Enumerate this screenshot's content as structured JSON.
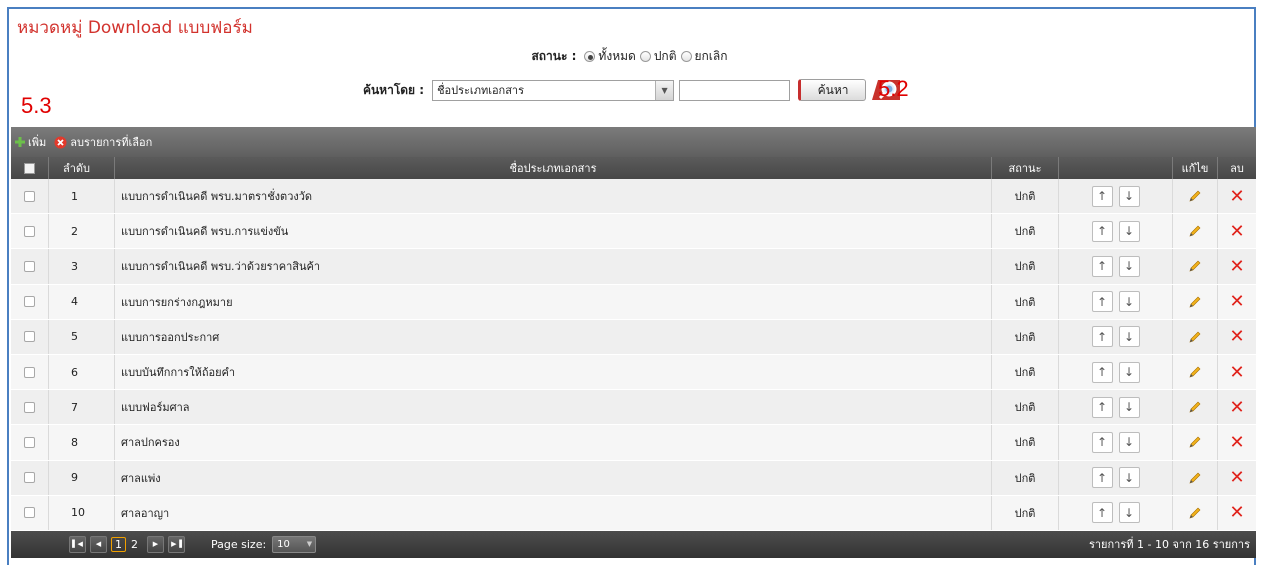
{
  "page": {
    "title": "หมวดหมู่ Download แบบฟอร์ม",
    "annotations": {
      "left": "5.3",
      "search": "5.2"
    }
  },
  "filter": {
    "status_label": "สถานะ :",
    "status_options": [
      {
        "label": "ทั้งหมด",
        "checked": true
      },
      {
        "label": "ปกติ",
        "checked": false
      },
      {
        "label": "ยกเลิก",
        "checked": false
      }
    ],
    "search_by_label": "ค้นหาโดย :",
    "search_by_value": "ชื่อประเภทเอกสาร",
    "search_text_value": "",
    "search_button": "ค้นหา"
  },
  "toolbar": {
    "add_label": "เพิ่ม",
    "delete_selected_label": "ลบรายการที่เลือก"
  },
  "table": {
    "headers": {
      "order": "ลำดับ",
      "name": "ชื่อประเภทเอกสาร",
      "status": "สถานะ",
      "edit": "แก้ไข",
      "delete": "ลบ"
    },
    "rows": [
      {
        "no": "1",
        "name": "แบบการดำเนินคดี พรบ.มาตราชั่งตวงวัด",
        "status": "ปกติ"
      },
      {
        "no": "2",
        "name": "แบบการดำเนินคดี พรบ.การแข่งขัน",
        "status": "ปกติ"
      },
      {
        "no": "3",
        "name": "แบบการดำเนินคดี พรบ.ว่าด้วยราคาสินค้า",
        "status": "ปกติ"
      },
      {
        "no": "4",
        "name": "แบบการยกร่างกฎหมาย",
        "status": "ปกติ"
      },
      {
        "no": "5",
        "name": "แบบการออกประกาศ",
        "status": "ปกติ"
      },
      {
        "no": "6",
        "name": "แบบบันทึกการให้ถ้อยคำ",
        "status": "ปกติ"
      },
      {
        "no": "7",
        "name": "แบบฟอร์มศาล",
        "status": "ปกติ"
      },
      {
        "no": "8",
        "name": "ศาลปกครอง",
        "status": "ปกติ"
      },
      {
        "no": "9",
        "name": "ศาลแพ่ง",
        "status": "ปกติ"
      },
      {
        "no": "10",
        "name": "ศาลอาญา",
        "status": "ปกติ"
      }
    ]
  },
  "pager": {
    "pages": [
      "1",
      "2"
    ],
    "current_page": "1",
    "page_size_label": "Page size:",
    "page_size_value": "10",
    "info": "รายการที่ 1 - 10 จาก 16 รายการ"
  },
  "icons": {
    "add": "plus-icon",
    "delete_selected": "delete-circle-icon",
    "move_up": "arrow-up-icon",
    "move_down": "arrow-down-icon",
    "edit": "pencil-icon",
    "delete": "x-icon",
    "search": "magnifier-icon"
  },
  "colors": {
    "title": "#d2322d",
    "annotation": "#e00000",
    "frame_border": "#4a7fc1",
    "delete_icon": "#e0221b"
  }
}
